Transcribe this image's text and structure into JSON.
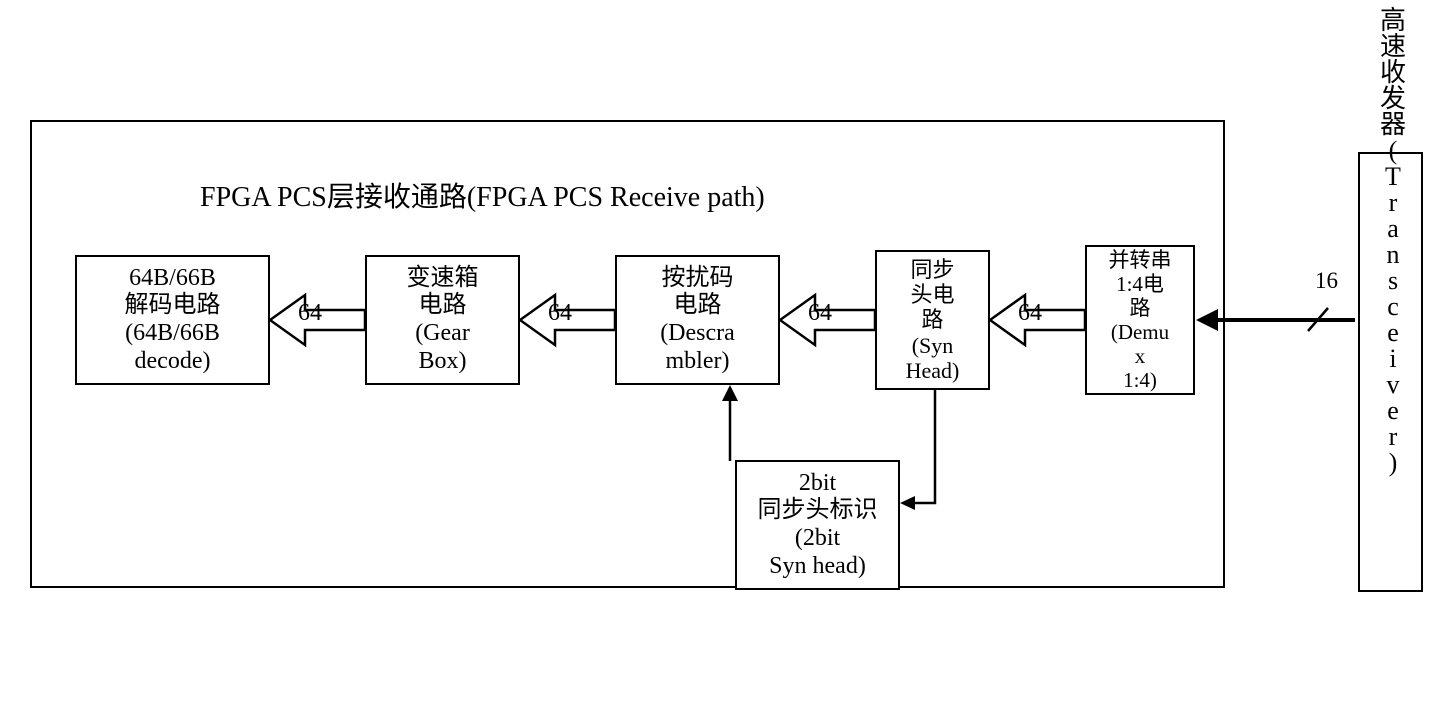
{
  "title": "FPGA PCS层接收通路(FPGA PCS Receive path)",
  "boxes": {
    "decode": {
      "line1": "64B/66B",
      "line2": "解码电路",
      "line3": "(64B/66B",
      "line4": "decode)"
    },
    "gearbox": {
      "line1": "变速箱",
      "line2": "电路",
      "line3": "(Gear",
      "line4": "Box)"
    },
    "descrambler": {
      "line1": "按扰码",
      "line2": "电路",
      "line3": "(Descra",
      "line4": "mbler)"
    },
    "synhead": {
      "line1": "同步",
      "line2": "头电",
      "line3": "路",
      "line4": "(Syn",
      "line5": "Head)"
    },
    "demux": {
      "line1": "并转串",
      "line2": "1:4电",
      "line3": "路",
      "line4": "(Demu",
      "line5": "x",
      "line6": "1:4)"
    },
    "synheadid": {
      "line1": "2bit",
      "line2": "同步头标识",
      "line3": "(2bit",
      "line4": "Syn head)"
    }
  },
  "arrows": {
    "w64": "64"
  },
  "bus": {
    "label": "16"
  },
  "transceiver": {
    "pre": "高速收发器",
    "paren_open": "(",
    "body": "Transceiver",
    "paren_close": ")"
  }
}
